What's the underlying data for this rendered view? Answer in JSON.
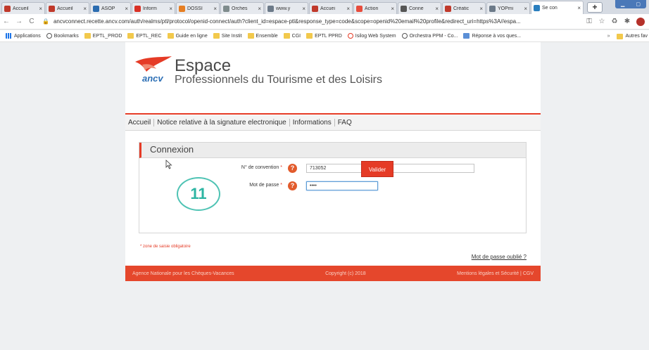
{
  "browser": {
    "tabs": [
      {
        "label": "Accueil",
        "icon": "tourism-favicon",
        "color": "#c0392b"
      },
      {
        "label": "Accueil",
        "icon": "tourism-favicon",
        "color": "#c0392b"
      },
      {
        "label": "ASOP",
        "icon": "jira-favicon",
        "color": "#2b6cb0"
      },
      {
        "label": "Inform",
        "icon": "gmail-favicon",
        "color": "#d93025"
      },
      {
        "label": "DOSSI",
        "icon": "orchestra-favicon",
        "color": "#e67e22"
      },
      {
        "label": "Orches",
        "icon": "circle-favicon",
        "color": "#7f8c8d"
      },
      {
        "label": "www.y",
        "icon": "yopmail-favicon",
        "color": "#6c7a89"
      },
      {
        "label": "Accuei",
        "icon": "tourism-favicon",
        "color": "#c0392b"
      },
      {
        "label": "Action",
        "icon": "action-favicon",
        "color": "#e74c3c"
      },
      {
        "label": "Conne",
        "icon": "globe-favicon",
        "color": "#555555"
      },
      {
        "label": "Créatic",
        "icon": "tourism-favicon",
        "color": "#c0392b"
      },
      {
        "label": "YOPmi",
        "icon": "yopmail-favicon",
        "color": "#6c7a89"
      },
      {
        "label": "Se con",
        "icon": "ancv-favicon",
        "color": "#2a7fbf",
        "active": true
      }
    ],
    "new_tab_label": "+",
    "url": "ancvconnect.recette.ancv.com/auth/realms/ptl/protocol/openid-connect/auth?client_id=espace-ptl&response_type=code&scope=openid%20email%20profile&redirect_uri=https%3A//espa...",
    "bookmarks": [
      {
        "label": "Applications",
        "icon": "apps-icon"
      },
      {
        "label": "Bookmarks",
        "icon": "globe-icon"
      },
      {
        "label": "EPTL_PROD",
        "icon": "folder-icon"
      },
      {
        "label": "EPTL_REC",
        "icon": "folder-icon"
      },
      {
        "label": "Guide en ligne",
        "icon": "folder-icon"
      },
      {
        "label": "Site Instit",
        "icon": "folder-icon"
      },
      {
        "label": "Ensemble",
        "icon": "folder-icon"
      },
      {
        "label": "CGI",
        "icon": "folder-icon"
      },
      {
        "label": "EPTL PPRD",
        "icon": "folder-icon"
      },
      {
        "label": "Isilog Web System",
        "icon": "isilog-icon"
      },
      {
        "label": "Orchestra PPM - Co...",
        "icon": "circle-icon"
      },
      {
        "label": "Réponse à vos ques...",
        "icon": "sncf-icon"
      }
    ],
    "bookmarks_more": "»",
    "bookmarks_other": "Autres fav"
  },
  "site": {
    "logo_text": "ancv",
    "title": "Espace",
    "subtitle": "Professionnels du Tourisme et des Loisirs",
    "nav": [
      "Accueil",
      "Notice relative à la signature electronique",
      "Informations",
      "FAQ"
    ],
    "brand_color": "#e53b26"
  },
  "login": {
    "heading": "Connexion",
    "convention_label": "N° de convention",
    "convention_value": "713052",
    "password_label": "Mot de passe",
    "password_value": "••••",
    "required_mark": "*",
    "help_symbol": "?",
    "submit_label": "Valider",
    "required_note": "* zone de saisie obligatoire",
    "forgot_label": "Mot de passe oublié ?"
  },
  "footer": {
    "left": "Agence Nationale pour les Chèques-Vacances",
    "center": "Copyright (c) 2018",
    "right": "Mentions légales et Sécurité | CGV"
  },
  "step_badge": "11"
}
